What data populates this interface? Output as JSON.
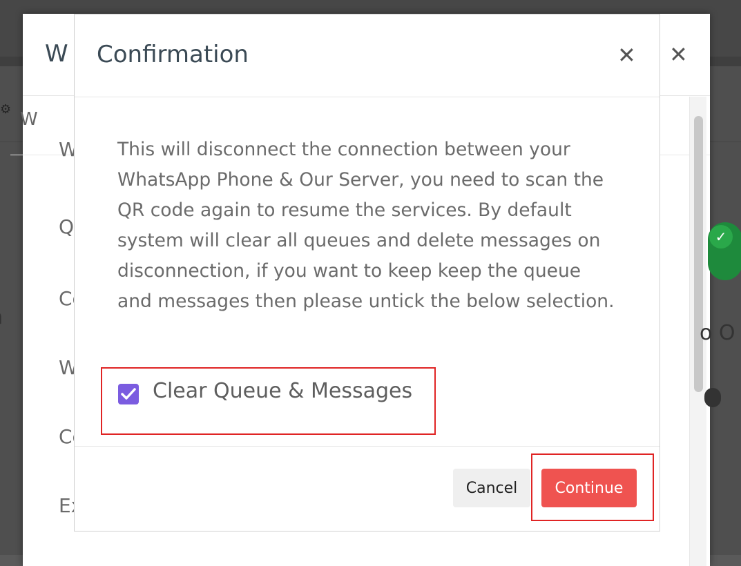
{
  "background": {
    "left_fragment": "na",
    "right_fragment": "o O"
  },
  "outer_modal": {
    "title_fragment": "W",
    "subheader_fragment": "W",
    "items": [
      "W",
      "Q",
      "Co",
      "W",
      "Co",
      "Ex"
    ],
    "close_icon": "close-icon"
  },
  "dialog": {
    "title": "Confirmation",
    "close_icon": "close-icon",
    "message": "This will disconnect the connection between your WhatsApp Phone & Our Server, you need to scan the QR code again to resume the services. By default system will clear all queues and delete messages on disconnection, if you want to keep keep the queue and messages then please untick the below selection.",
    "checkbox": {
      "label": "Clear Queue & Messages",
      "checked": true,
      "color": "#7b5ce0"
    },
    "cancel_label": "Cancel",
    "continue_label": "Continue",
    "continue_color": "#ef5350",
    "highlight_color": "#e02424"
  }
}
